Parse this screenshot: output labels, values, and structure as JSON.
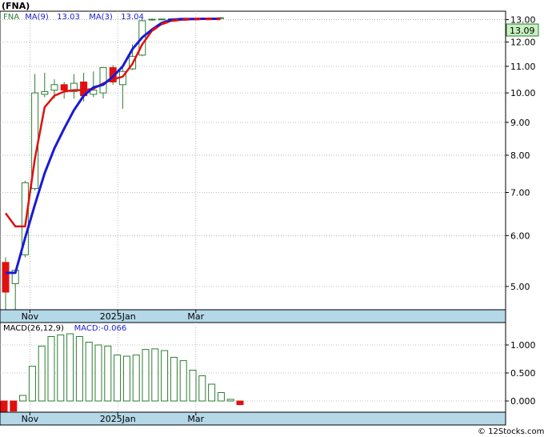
{
  "title": "(FNA)",
  "footer": "© 12Stocks.com",
  "colors": {
    "up": "#2e7d32",
    "down": "#e01010",
    "ma9": "#e01010",
    "ma3": "#1a1ad6",
    "axis_band": "#b4d8e8",
    "grid": "#aaaaaa",
    "macd_bar": "#2e7d32",
    "last_box": "#c8f0c0"
  },
  "chart_data": [
    {
      "type": "candlestick",
      "legend": [
        {
          "label": "FNA",
          "color": "#2e7d32"
        },
        {
          "label": "MA(9)",
          "color": "#1a1ad6"
        },
        {
          "label": "13.03",
          "color": "#1a1ad6"
        },
        {
          "label": "MA(3)",
          "color": "#1a1ad6"
        },
        {
          "label": "13.04",
          "color": "#1a1ad6"
        }
      ],
      "last_value": "13.09",
      "scale": "log",
      "ylim": [
        4.6,
        13.4
      ],
      "y_ticks": [
        5.0,
        6.0,
        7.0,
        8.0,
        9.0,
        10.0,
        11.0,
        12.0,
        13.0
      ],
      "y_tick_labels": [
        "5.00",
        "6.00",
        "7.00",
        "8.00",
        "9.00",
        "10.00",
        "11.00",
        "12.00",
        "13.00"
      ],
      "x_labels": [
        {
          "label": "Nov",
          "index": 2
        },
        {
          "label": "2025Jan",
          "index": 11
        },
        {
          "label": "Mar",
          "index": 19
        }
      ],
      "candles": [
        {
          "o": 5.45,
          "h": 5.55,
          "l": 4.6,
          "c": 4.9
        },
        {
          "o": 5.05,
          "h": 5.25,
          "l": 4.6,
          "c": 5.3
        },
        {
          "o": 5.6,
          "h": 7.3,
          "l": 5.55,
          "c": 7.25
        },
        {
          "o": 7.1,
          "h": 10.7,
          "l": 7.05,
          "c": 10.0
        },
        {
          "o": 9.95,
          "h": 10.75,
          "l": 9.85,
          "c": 10.05
        },
        {
          "o": 10.1,
          "h": 10.5,
          "l": 9.8,
          "c": 10.3
        },
        {
          "o": 10.3,
          "h": 10.4,
          "l": 9.8,
          "c": 10.1
        },
        {
          "o": 10.05,
          "h": 10.7,
          "l": 9.8,
          "c": 10.35
        },
        {
          "o": 10.4,
          "h": 10.75,
          "l": 9.7,
          "c": 9.9
        },
        {
          "o": 9.95,
          "h": 10.8,
          "l": 9.85,
          "c": 10.1
        },
        {
          "o": 10.0,
          "h": 10.95,
          "l": 9.8,
          "c": 10.95
        },
        {
          "o": 10.95,
          "h": 11.05,
          "l": 10.3,
          "c": 10.4
        },
        {
          "o": 10.3,
          "h": 10.95,
          "l": 9.45,
          "c": 10.8
        },
        {
          "o": 10.9,
          "h": 11.9,
          "l": 10.85,
          "c": 11.4
        },
        {
          "o": 11.45,
          "h": 13.05,
          "l": 11.4,
          "c": 12.95
        },
        {
          "o": 13.0,
          "h": 13.05,
          "l": 12.95,
          "c": 13.02
        },
        {
          "o": 13.02,
          "h": 13.05,
          "l": 12.98,
          "c": 13.03
        },
        {
          "o": 13.03,
          "h": 13.06,
          "l": 13.0,
          "c": 13.04
        },
        {
          "o": 13.04,
          "h": 13.06,
          "l": 13.01,
          "c": 13.05
        },
        {
          "o": 13.05,
          "h": 13.08,
          "l": 13.02,
          "c": 13.06
        },
        {
          "o": 13.06,
          "h": 13.08,
          "l": 13.04,
          "c": 13.07
        },
        {
          "o": 13.07,
          "h": 13.1,
          "l": 13.05,
          "c": 13.08
        },
        {
          "o": 13.08,
          "h": 13.12,
          "l": 13.06,
          "c": 13.09
        }
      ],
      "series": [
        {
          "legend_label": "MA(9)",
          "color": "#e01010",
          "values": [
            6.5,
            6.2,
            6.2,
            7.9,
            9.5,
            9.9,
            10.05,
            10.1,
            10.1,
            10.15,
            10.35,
            10.5,
            10.6,
            11.1,
            11.9,
            12.5,
            12.8,
            12.95,
            13.0,
            13.02,
            13.03,
            13.03,
            13.03
          ]
        },
        {
          "legend_label": "MA(3)",
          "color": "#1a1ad6",
          "values": [
            5.25,
            5.25,
            5.95,
            6.7,
            7.5,
            8.2,
            8.8,
            9.4,
            9.9,
            10.2,
            10.3,
            10.6,
            11.0,
            11.7,
            12.2,
            12.55,
            12.85,
            13.0,
            13.03,
            13.03,
            13.04,
            13.04,
            13.04
          ]
        }
      ]
    },
    {
      "type": "bar",
      "legend": [
        {
          "label": "MACD(26,12,9)",
          "color": "#000000"
        },
        {
          "label": "MACD:-0.066",
          "color": "#1a1ad6"
        }
      ],
      "ylim": [
        -0.2,
        1.4
      ],
      "y_ticks": [
        0.0,
        0.5,
        1.0
      ],
      "y_tick_labels": [
        "0.000",
        "0.500",
        "1.000"
      ],
      "x_labels": [
        {
          "label": "Nov",
          "index": 2
        },
        {
          "label": "2025Jan",
          "index": 11
        },
        {
          "label": "Mar",
          "index": 19
        }
      ],
      "values": [
        -0.25,
        -0.18,
        0.1,
        0.62,
        0.98,
        1.15,
        1.18,
        1.2,
        1.15,
        1.05,
        1.0,
        0.98,
        0.82,
        0.8,
        0.82,
        0.92,
        0.93,
        0.9,
        0.78,
        0.72,
        0.55,
        0.45,
        0.3,
        0.15,
        0.03,
        -0.066
      ]
    }
  ]
}
